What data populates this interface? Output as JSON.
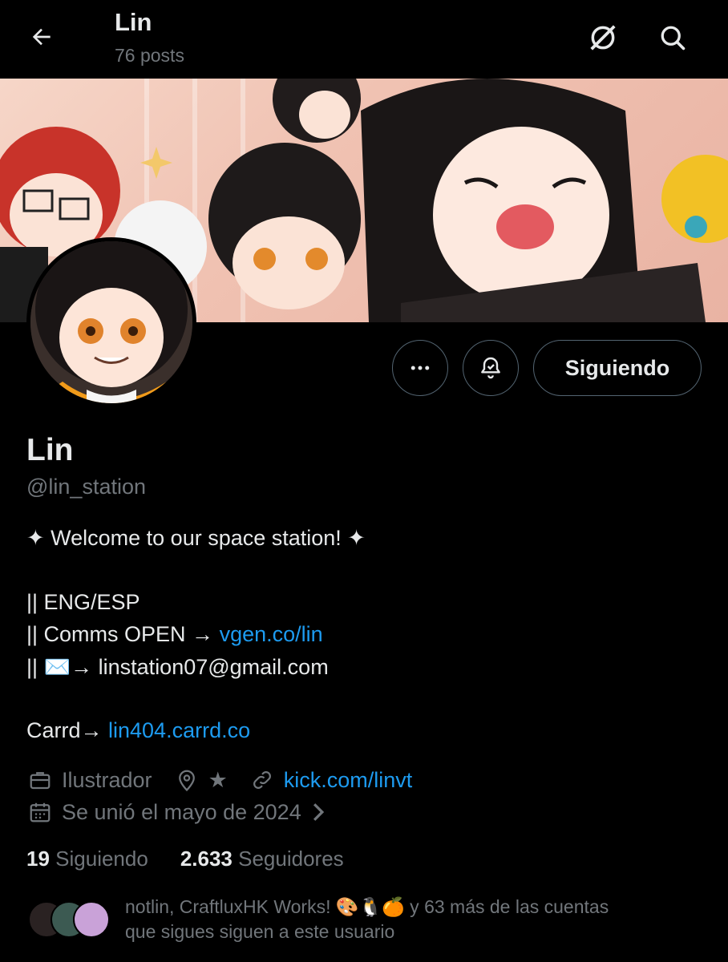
{
  "header": {
    "title": "Lin",
    "posts_count": "76 posts"
  },
  "profile": {
    "name": "Lin",
    "handle": "@lin_station",
    "follow_button_label": "Siguiendo"
  },
  "bio": {
    "line1": "✦ Welcome to our space station! ✦",
    "line2": "|| ENG/ESP",
    "line3_prefix": "|| Comms OPEN → ",
    "line3_link": "vgen.co/lin",
    "line4_prefix": "|| ✉️→ ",
    "line4_email": "linstation07@gmail.com",
    "line5_prefix": "Carrd→ ",
    "line5_link": "lin404.carrd.co"
  },
  "meta": {
    "profession": "Ilustrador",
    "location": "★",
    "website": "kick.com/linvt",
    "joined": "Se unió el mayo de 2024"
  },
  "stats": {
    "following_count": "19",
    "following_label": "Siguiendo",
    "followers_count": "2.633",
    "followers_label": "Seguidores"
  },
  "followed_by": {
    "line1": "notlin, CraftluxHK Works! 🎨🐧🍊 y 63 más de las cuentas",
    "line2": "que sigues siguen a este usuario"
  },
  "icons": {
    "back": "arrow-left-icon",
    "grok": "grok-icon",
    "search": "search-icon",
    "more": "more-icon",
    "notifications": "bell-check-icon",
    "briefcase": "briefcase-icon",
    "location": "location-pin-icon",
    "link": "link-icon",
    "calendar": "calendar-icon"
  },
  "colors": {
    "background": "#000000",
    "text": "#e7e9ea",
    "muted": "#71767b",
    "link": "#1d9bf0",
    "border": "#536471"
  }
}
